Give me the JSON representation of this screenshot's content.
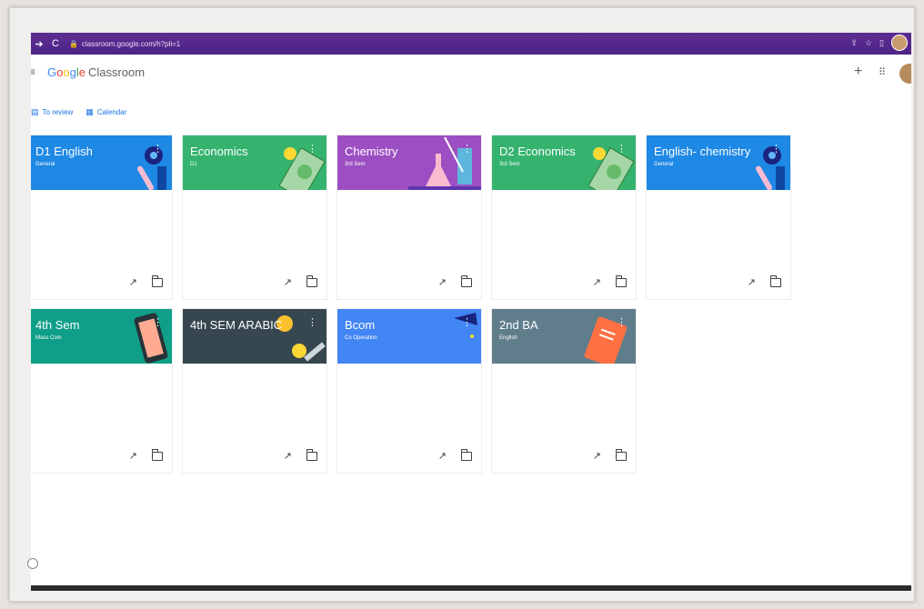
{
  "browser": {
    "url": "classroom.google.com/h?pli=1"
  },
  "app": {
    "brand_google": [
      "G",
      "o",
      "o",
      "g",
      "l",
      "e"
    ],
    "brand_product": "Classroom"
  },
  "nav": {
    "to_review": "To review",
    "calendar": "Calendar"
  },
  "colors": {
    "blue": "#1e88e5",
    "green": "#35b36e",
    "purple": "#9c4fc2",
    "teal": "#0f9e87",
    "dark": "#37474f",
    "brightblue": "#4285f4",
    "slate": "#607d8b"
  },
  "classes": [
    {
      "title": "D1 English",
      "subtitle": "General",
      "color": "#1e88e5",
      "art": "robot-icon"
    },
    {
      "title": "Economics",
      "subtitle": "D1",
      "color": "#35b36e",
      "art": "money-icon"
    },
    {
      "title": "Chemistry",
      "subtitle": "3rd Sem",
      "color": "#9c4fc2",
      "art": "flask-icon"
    },
    {
      "title": "D2 Economics",
      "subtitle": "3rd Sem",
      "color": "#35b36e",
      "art": "money-icon"
    },
    {
      "title": "English- chemistry",
      "subtitle": "General",
      "color": "#1e88e5",
      "art": "robot-icon"
    },
    {
      "title": "4th Sem",
      "subtitle": "Mass Com",
      "color": "#0f9e87",
      "art": "phone-icon"
    },
    {
      "title": "4th SEM ARABIC",
      "subtitle": "",
      "color": "#37474f",
      "art": "coin-icon"
    },
    {
      "title": "Bcom",
      "subtitle": "Co Operation",
      "color": "#4285f4",
      "art": "cap-icon"
    },
    {
      "title": "2nd BA",
      "subtitle": "English",
      "color": "#607d8b",
      "art": "book-icon"
    }
  ]
}
